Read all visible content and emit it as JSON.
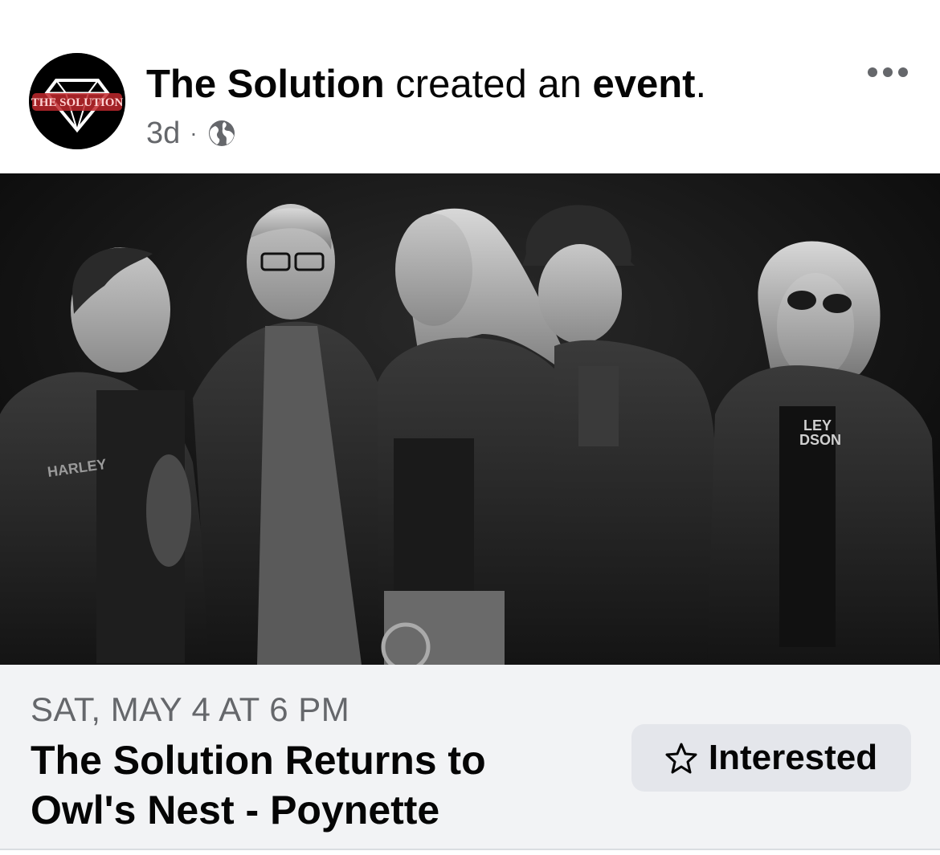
{
  "post": {
    "author": "The Solution",
    "action_text": " created an ",
    "action_object": "event",
    "action_end": ".",
    "time": "3d",
    "separator": "·",
    "audience_icon": "globe-icon",
    "more_icon": "more-options-icon"
  },
  "avatar": {
    "logo_text": "THE SOLUTION",
    "icon": "diamond-logo"
  },
  "event": {
    "date": "SAT, MAY 4 AT 6 PM",
    "title": "The Solution Returns to Owl's Nest - Poynette",
    "button_label": "Interested",
    "button_icon": "star-outline-icon"
  },
  "photo": {
    "jacket_text_1": "HARLEY",
    "jacket_text_2": "LEY",
    "jacket_text_3": "DSON"
  },
  "colors": {
    "muted_text": "#65676b",
    "card_bg": "#f2f3f5",
    "button_bg": "#e4e6eb",
    "logo_red": "#c0282d"
  }
}
